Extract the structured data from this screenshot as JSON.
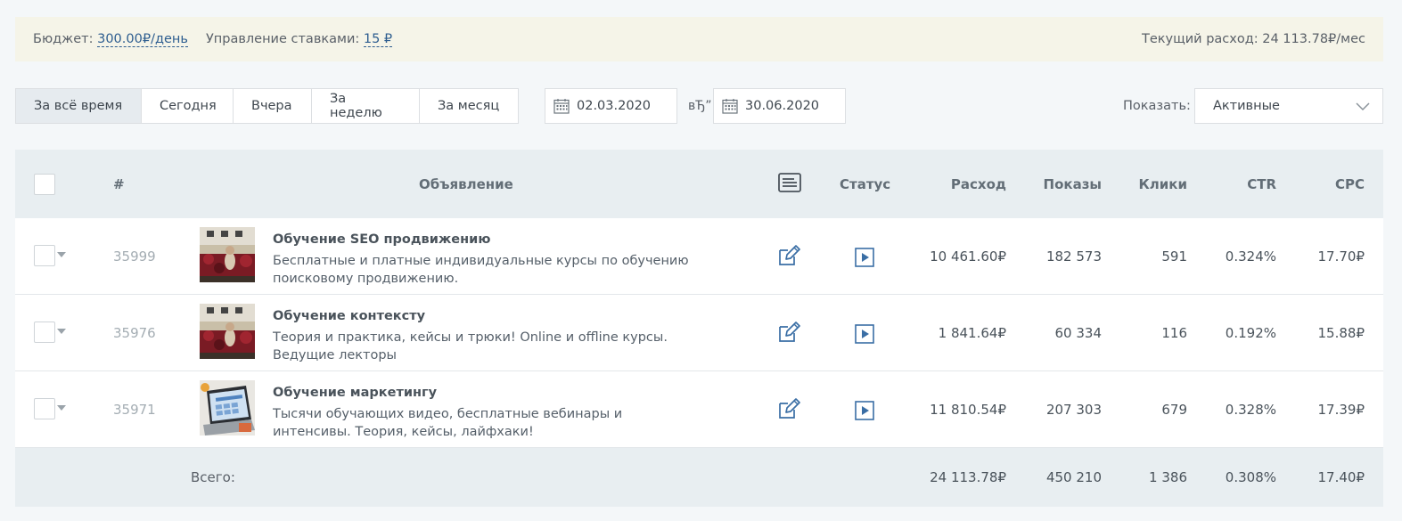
{
  "budget": {
    "budget_label": "Бюджет:",
    "budget_value": "300.00₽/день",
    "bid_label": "Управление ставками:",
    "bid_value": "15 ₽",
    "current_spend": "Текущий расход: 24 113.78₽/мес"
  },
  "filters": {
    "periods": [
      "За всё время",
      "Сегодня",
      "Вчера",
      "За неделю",
      "За месяц"
    ],
    "active_period": "За всё время",
    "date_from": "02.03.2020",
    "date_separator": "вЂ”",
    "date_to": "30.06.2020",
    "show_label": "Показать:",
    "show_value": "Активные"
  },
  "table": {
    "headers": {
      "id": "#",
      "ad": "Объявление",
      "status": "Статус",
      "spend": "Расход",
      "impressions": "Показы",
      "clicks": "Клики",
      "ctr": "CTR",
      "cpc": "CPC"
    },
    "icons": {
      "header_text": "text-lines-icon",
      "edit": "edit-pencil-icon",
      "status": "play-icon",
      "calendar": "calendar-icon",
      "dropdown": "chevron-down-icon"
    },
    "rows": [
      {
        "id": "35999",
        "title": "Обучение SEO продвижению",
        "desc": "Бесплатные и платные индивидуальные курсы по обучению поисковому продвижению.",
        "spend": "10 461.60₽",
        "impressions": "182 573",
        "clicks": "591",
        "ctr": "0.324%",
        "cpc": "17.70₽"
      },
      {
        "id": "35976",
        "title": "Обучение контексту",
        "desc": "Теория и практика, кейсы и трюки! Online и offline курсы. Ведущие лекторы",
        "spend": "1 841.64₽",
        "impressions": "60 334",
        "clicks": "116",
        "ctr": "0.192%",
        "cpc": "15.88₽"
      },
      {
        "id": "35971",
        "title": "Обучение маркетингу",
        "desc": "Тысячи обучающих видео, бесплатные вебинары и интенсивы. Теория, кейсы, лайфхаки!",
        "spend": "11 810.54₽",
        "impressions": "207 303",
        "clicks": "679",
        "ctr": "0.328%",
        "cpc": "17.39₽"
      }
    ],
    "totals": {
      "label": "Всего:",
      "spend": "24 113.78₽",
      "impressions": "450 210",
      "clicks": "1 386",
      "ctr": "0.308%",
      "cpc": "17.40₽"
    }
  },
  "colors": {
    "accent_link": "#2d5d8f",
    "icon_blue": "#3a6ea5",
    "header_bg": "#e8eef1",
    "budget_bg": "#f5f4e8"
  }
}
